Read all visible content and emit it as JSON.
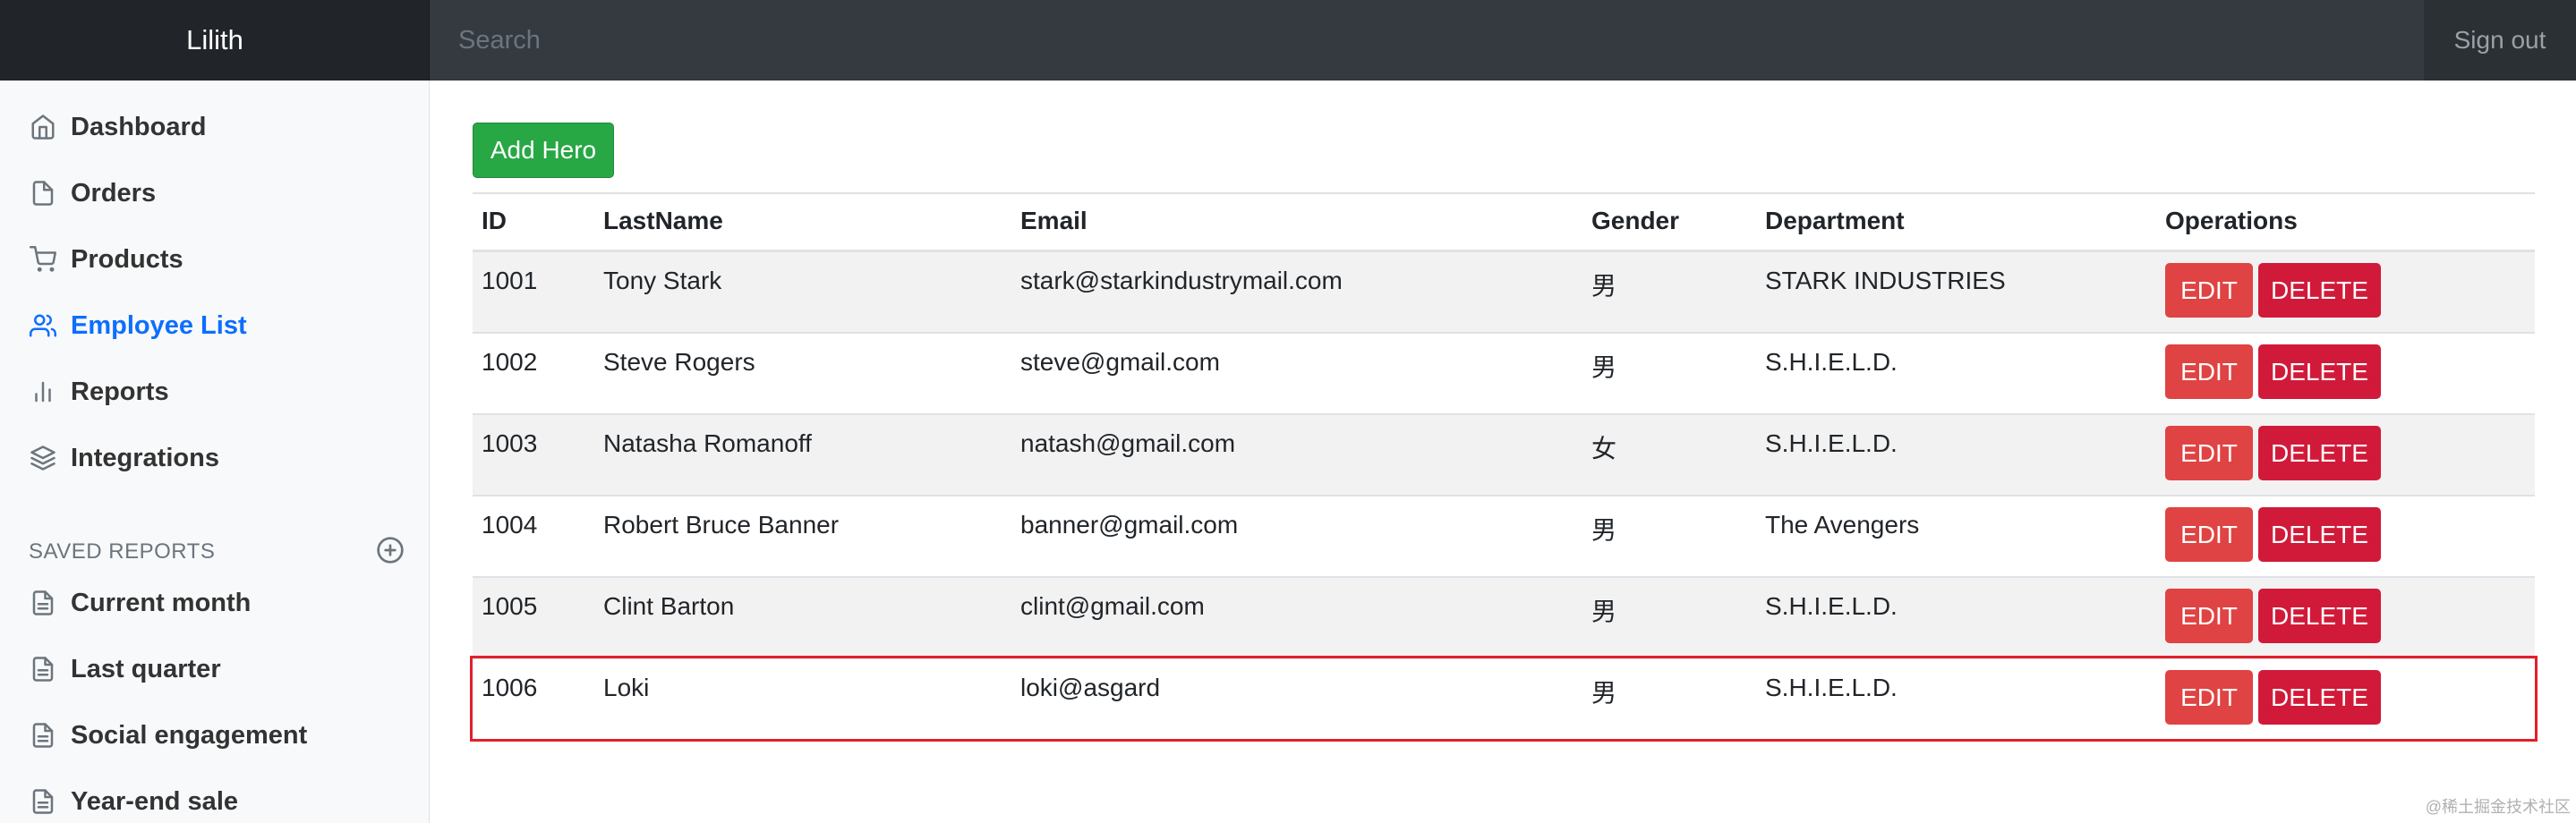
{
  "navbar": {
    "brand": "Lilith",
    "search_placeholder": "Search",
    "signout_label": "Sign out"
  },
  "sidebar": {
    "items": [
      {
        "label": "Dashboard",
        "icon": "home-icon"
      },
      {
        "label": "Orders",
        "icon": "file-icon"
      },
      {
        "label": "Products",
        "icon": "shopping-cart-icon"
      },
      {
        "label": "Employee List",
        "icon": "users-icon",
        "active": true
      },
      {
        "label": "Reports",
        "icon": "bar-chart-icon"
      },
      {
        "label": "Integrations",
        "icon": "layers-icon"
      }
    ],
    "saved_reports_heading": "SAVED REPORTS",
    "saved_reports": [
      {
        "label": "Current month",
        "icon": "file-text-icon"
      },
      {
        "label": "Last quarter",
        "icon": "file-text-icon"
      },
      {
        "label": "Social engagement",
        "icon": "file-text-icon"
      },
      {
        "label": "Year-end sale",
        "icon": "file-text-icon"
      }
    ]
  },
  "main": {
    "add_button_label": "Add Hero",
    "table": {
      "headers": [
        "ID",
        "LastName",
        "Email",
        "Gender",
        "Department",
        "Operations"
      ],
      "rows": [
        {
          "id": "1001",
          "last_name": "Tony Stark",
          "email": "stark@starkindustrymail.com",
          "gender": "男",
          "department": "STARK INDUSTRIES"
        },
        {
          "id": "1002",
          "last_name": "Steve Rogers",
          "email": "steve@gmail.com",
          "gender": "男",
          "department": "S.H.I.E.L.D."
        },
        {
          "id": "1003",
          "last_name": "Natasha Romanoff",
          "email": "natash@gmail.com",
          "gender": "女",
          "department": "S.H.I.E.L.D."
        },
        {
          "id": "1004",
          "last_name": "Robert Bruce Banner",
          "email": "banner@gmail.com",
          "gender": "男",
          "department": "The Avengers"
        },
        {
          "id": "1005",
          "last_name": "Clint Barton",
          "email": "clint@gmail.com",
          "gender": "男",
          "department": "S.H.I.E.L.D."
        },
        {
          "id": "1006",
          "last_name": "Loki",
          "email": "loki@asgard",
          "gender": "男",
          "department": "S.H.I.E.L.D."
        }
      ],
      "edit_label": "EDIT",
      "delete_label": "DELETE",
      "highlighted_row": "1006"
    }
  },
  "watermark": "@稀土掘金技术社区",
  "colors": {
    "navbar_bg": "#343a40",
    "brand_bg": "#212529",
    "active_link": "#0d6efd",
    "add_button": "#28a745",
    "edit_button": "#e04343",
    "delete_button": "#d11a3a",
    "highlight_border": "#e0202b"
  }
}
